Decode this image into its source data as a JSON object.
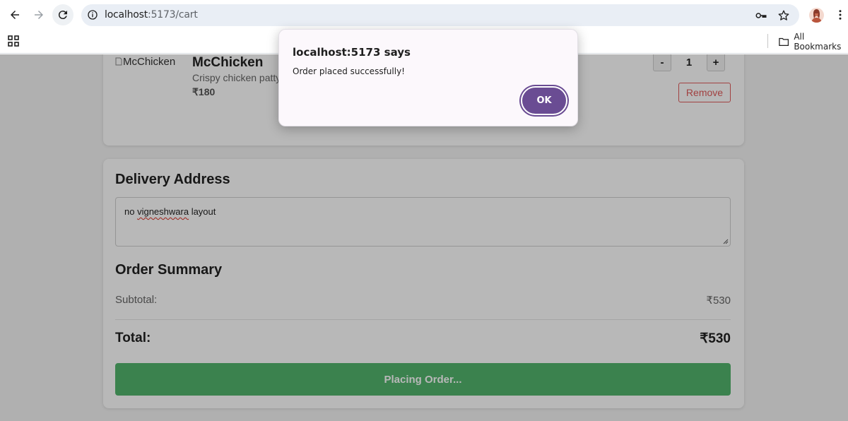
{
  "browser": {
    "url_host": "localhost",
    "url_path": ":5173/cart",
    "bookmarks_label": "All Bookmarks"
  },
  "cart": {
    "item": {
      "image_alt": "McChicken",
      "name": "McChicken",
      "description": "Crispy chicken patty",
      "price": "₹180",
      "quantity": "1",
      "decrement_label": "-",
      "increment_label": "+",
      "remove_label": "Remove"
    }
  },
  "delivery": {
    "title": "Delivery Address",
    "address_before": "no ",
    "address_misspelled": "vigneshwara",
    "address_after": " layout"
  },
  "summary": {
    "title": "Order Summary",
    "subtotal_label": "Subtotal:",
    "subtotal_value": "₹530",
    "total_label": "Total:",
    "total_value": "₹530",
    "place_order_label": "Placing Order..."
  },
  "dialog": {
    "title": "localhost:5173 says",
    "message": "Order placed successfully!",
    "ok_label": "OK"
  },
  "colors": {
    "accent": "#6a4c93",
    "success": "#34a853",
    "danger": "#e05a5a"
  }
}
